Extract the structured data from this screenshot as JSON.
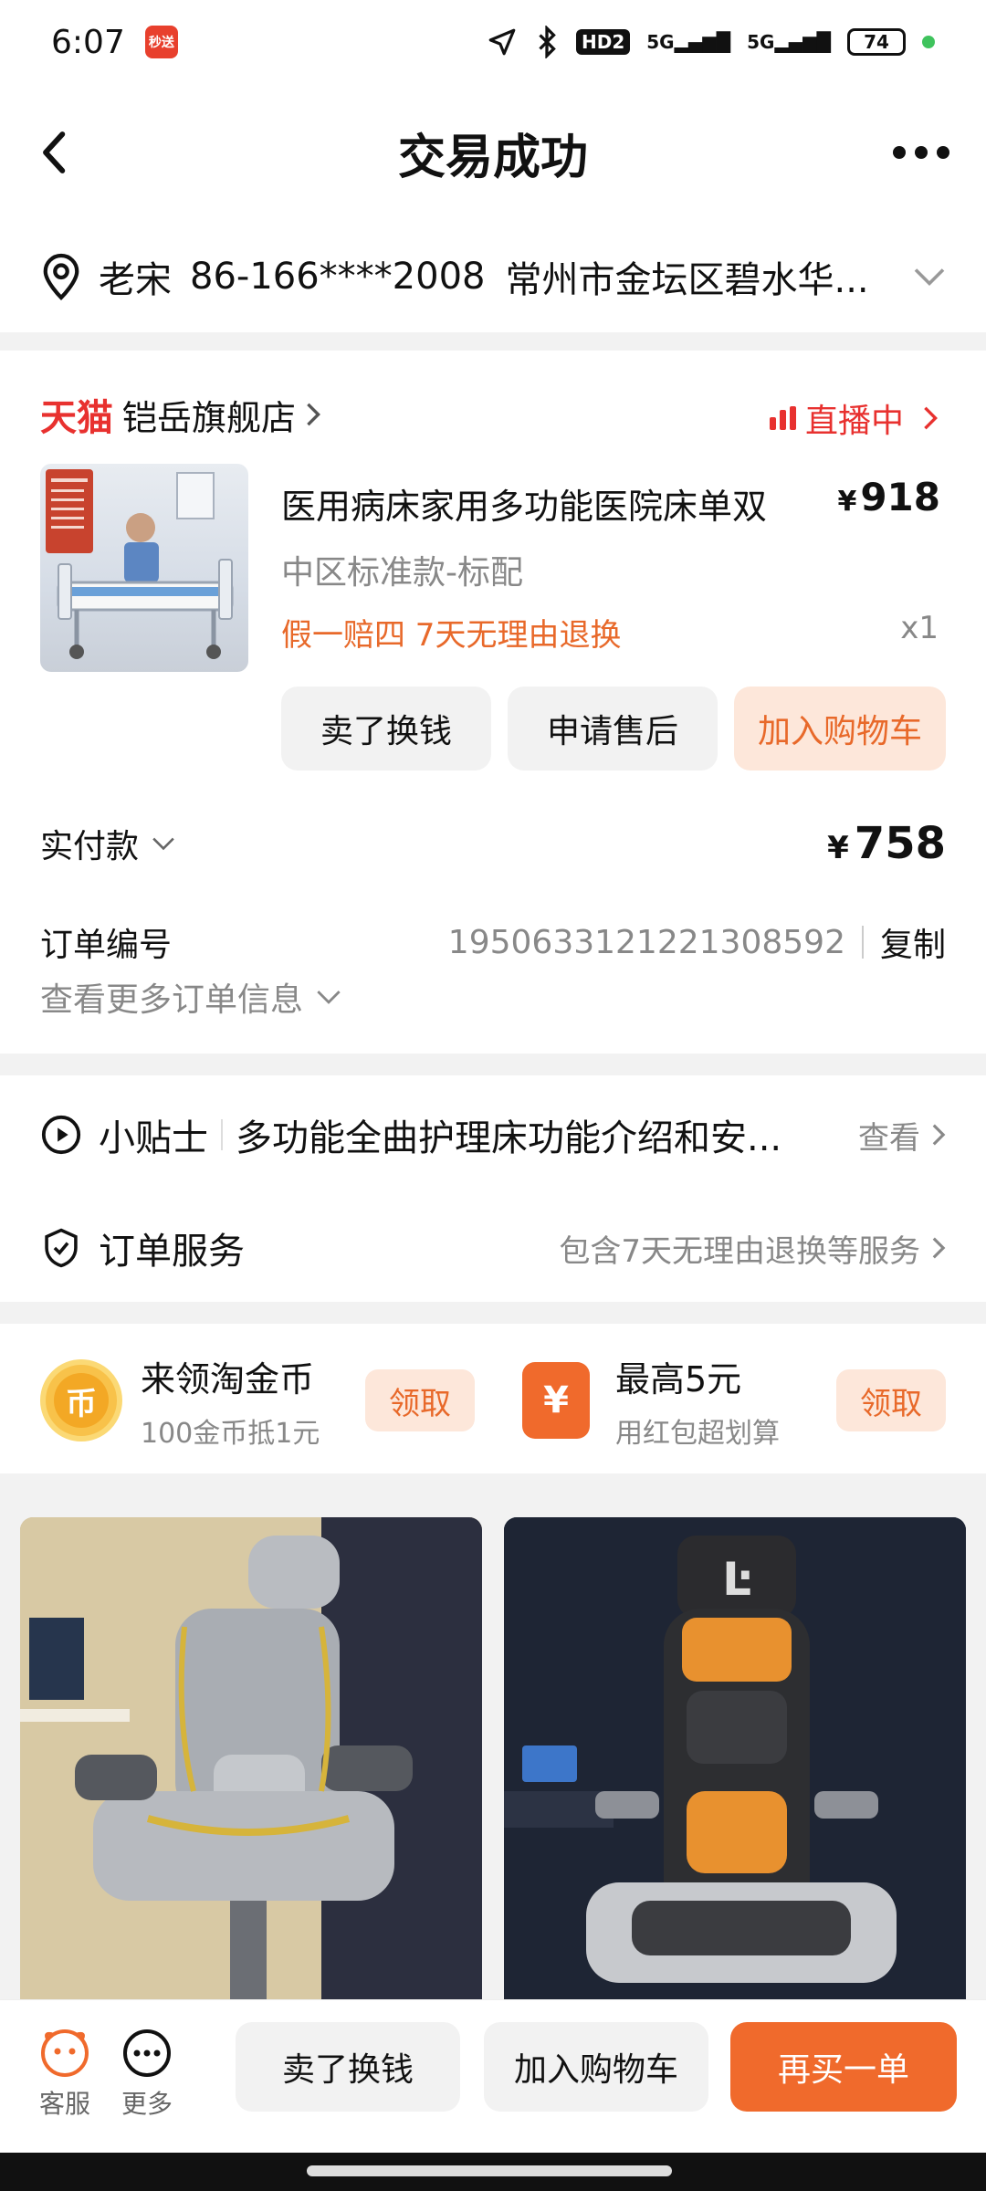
{
  "status_bar": {
    "time": "6:07",
    "app_badge": "秒送",
    "hd_label": "HD2",
    "signal1": "5G",
    "signal2": "5G",
    "battery": "74"
  },
  "header": {
    "title": "交易成功"
  },
  "address": {
    "name": "老宋",
    "phone": "86-166****2008",
    "text": "常州市金坛区碧水华..."
  },
  "shop": {
    "platform": "天猫",
    "name": "铠岳旗舰店",
    "live_label": "直播中"
  },
  "product": {
    "title": "医用病床家用多功能医院床单双",
    "price_symbol": "¥",
    "price": "918",
    "spec": "中区标准款-标配",
    "promise": "假一赔四  7天无理由退换",
    "quantity": "x1",
    "image_icon": "hospital-bed-photo"
  },
  "actions": {
    "sell": "卖了换钱",
    "after_sales": "申请售后",
    "add_cart": "加入购物车"
  },
  "payment": {
    "label": "实付款",
    "symbol": "¥",
    "amount": "758"
  },
  "order": {
    "number_label": "订单编号",
    "number": "1950633121221308592",
    "copy_label": "复制",
    "more_info": "查看更多订单信息"
  },
  "tips": {
    "title": "小贴士",
    "text": "多功能全曲护理床功能介绍和安...",
    "link": "查看"
  },
  "service": {
    "title": "订单服务",
    "desc": "包含7天无理由退换等服务"
  },
  "coupons": [
    {
      "icon": "gold-coin-icon",
      "glyph": "币",
      "title": "来领淘金币",
      "sub": "100金币抵1元",
      "button": "领取"
    },
    {
      "icon": "red-packet-icon",
      "glyph": "¥",
      "title": "最高5元",
      "sub": "用红包超划算",
      "button": "领取"
    }
  ],
  "recommendations": [
    {
      "image": "gray-gaming-chair-photo"
    },
    {
      "image": "black-orange-gaming-chair-photo"
    }
  ],
  "bottom_bar": {
    "service_label": "客服",
    "more_label": "更多",
    "sell": "卖了换钱",
    "add_cart": "加入购物车",
    "rebuy": "再买一单"
  },
  "colors": {
    "accent": "#f06a2c",
    "accent_light": "#fde7da",
    "tmall_red": "#e8312f",
    "muted_text": "#888888"
  }
}
